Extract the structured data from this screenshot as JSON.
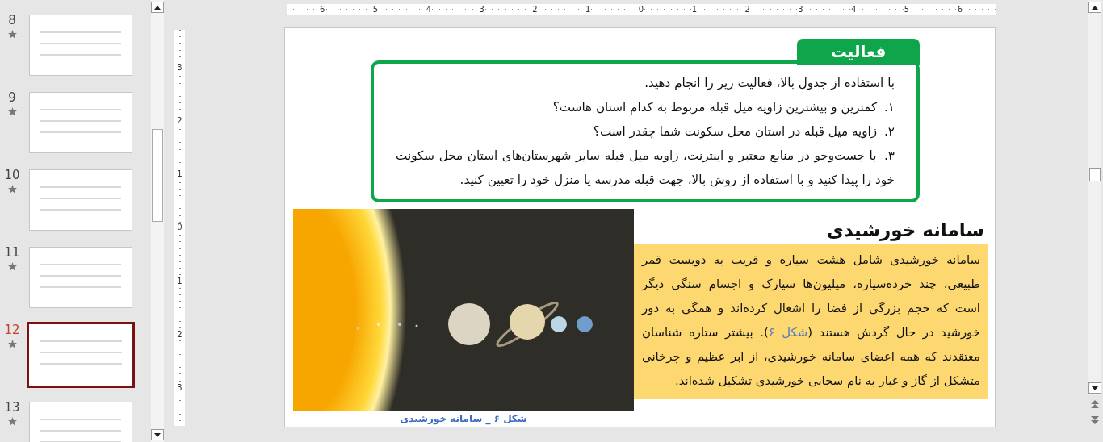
{
  "slide_panel": {
    "slides": [
      {
        "number": "8",
        "starred": true,
        "selected": false
      },
      {
        "number": "9",
        "starred": true,
        "selected": false
      },
      {
        "number": "10",
        "starred": true,
        "selected": false
      },
      {
        "number": "11",
        "starred": true,
        "selected": false
      },
      {
        "number": "12",
        "starred": true,
        "selected": true
      },
      {
        "number": "13",
        "starred": true,
        "selected": false
      }
    ]
  },
  "ruler": {
    "horizontal": [
      "6",
      "5",
      "4",
      "3",
      "2",
      "1",
      "0",
      "1",
      "2",
      "3",
      "4",
      "5",
      "6"
    ],
    "vertical": [
      "3",
      "2",
      "1",
      "0",
      "1",
      "2",
      "3"
    ]
  },
  "slide": {
    "activity": {
      "title": "فعالیت",
      "intro": "با استفاده از جدول بالا، فعالیت زیر را انجام دهید.",
      "items": [
        {
          "number": "۱.",
          "text": "کمترین و بیشترین زاویه میل قبله مربوط به کدام استان هاست؟"
        },
        {
          "number": "۲.",
          "text": "زاویه میل قبله در استان محل سکونت شما چقدر است؟"
        },
        {
          "number": "۳.",
          "text": "با جست‌وجو در منابع معتبر و اینترنت، زاویه میل قبله سایر شهرستان‌های استان محل سکونت خود را پیدا کنید و با استفاده از روش بالا، جهت قبله مدرسه یا منزل خود را تعیین کنید."
        }
      ]
    },
    "section": {
      "heading": "سامانه خورشیدی",
      "body_before": "سامانه خورشیدی شامل هشت سیاره و قریب به دویست قمر طبیعی، چند خرده‌سیاره، میلیون‌ها سیارک و اجسام سنگی دیگر است که حجم بزرگی از فضا را اشغال کرده‌اند و همگی به دور خورشید در حال گردش هستند (",
      "link": "شکل ۶",
      "body_after": "). بیشتر ستاره شناسان معتقدند که همه اعضای سامانه خورشیدی، از ابر عظیم و چرخانی متشکل از گاز و غبار به نام سحابی خورشیدی تشکیل شده‌اند."
    },
    "figure": {
      "caption": "شکل ۶ _ سامانه خورشیدی"
    }
  }
}
